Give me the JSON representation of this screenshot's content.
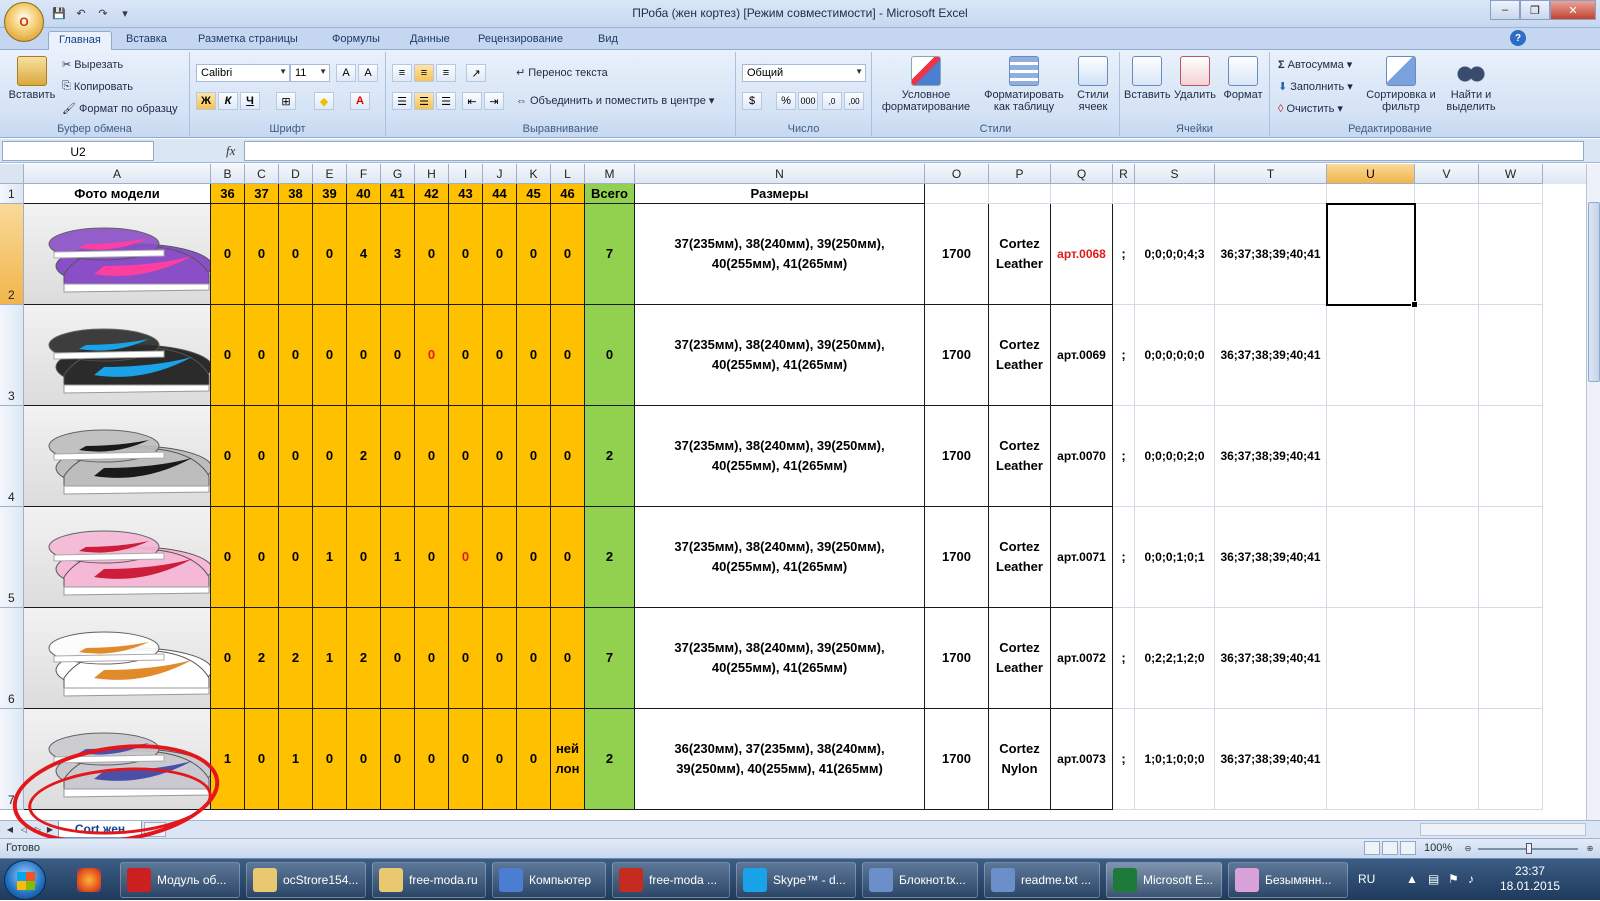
{
  "window": {
    "title": "ПРоба (жен кортез)  [Режим совместимости] - Microsoft Excel",
    "office_button": "O"
  },
  "ribbon_tabs": [
    "Главная",
    "Вставка",
    "Разметка страницы",
    "Формулы",
    "Данные",
    "Рецензирование",
    "Вид"
  ],
  "ribbon": {
    "clipboard": {
      "label": "Буфер обмена",
      "paste": "Вставить",
      "cut": "Вырезать",
      "copy": "Копировать",
      "format_painter": "Формат по образцу"
    },
    "font": {
      "label": "Шрифт",
      "name": "Calibri",
      "size": "11",
      "bold": "Ж",
      "italic": "К",
      "underline": "Ч"
    },
    "alignment": {
      "label": "Выравнивание",
      "wrap": "Перенос текста",
      "merge": "Объединить и поместить в центре"
    },
    "number": {
      "label": "Число",
      "format": "Общий"
    },
    "styles": {
      "label": "Стили",
      "conditional": "Условное форматирование",
      "as_table": "Форматировать как таблицу",
      "cell_styles": "Стили ячеек"
    },
    "cells": {
      "label": "Ячейки",
      "insert": "Вставить",
      "delete": "Удалить",
      "format": "Формат"
    },
    "editing": {
      "label": "Редактирование",
      "autosum": "Автосумма",
      "fill": "Заполнить",
      "clear": "Очистить",
      "sort": "Сортировка и фильтр",
      "find": "Найти и выделить"
    }
  },
  "formula_bar": {
    "name_box": "U2",
    "fx": "fx",
    "value": ""
  },
  "columns": [
    "A",
    "B",
    "C",
    "D",
    "E",
    "F",
    "G",
    "H",
    "I",
    "J",
    "K",
    "L",
    "M",
    "N",
    "O",
    "P",
    "Q",
    "R",
    "S",
    "T",
    "U",
    "V",
    "W"
  ],
  "header_row": [
    "Фото модели",
    "36",
    "37",
    "38",
    "39",
    "40",
    "41",
    "42",
    "43",
    "44",
    "45",
    "46",
    "Всего",
    "Размеры"
  ],
  "rows": [
    {
      "num": "2",
      "sizes": [
        "0",
        "0",
        "0",
        "0",
        "4",
        "3",
        "0",
        "0",
        "0",
        "0",
        "0"
      ],
      "total": "7",
      "dims": "37(235мм), 38(240мм), 39(250мм), 40(255мм), 41(265мм)",
      "price": "1700",
      "model": "Cortez Leather",
      "art": "арт.0068",
      "sep": ";",
      "counts": "0;0;0;0;4;3",
      "list": "36;37;38;39;40;41"
    },
    {
      "num": "3",
      "sizes": [
        "0",
        "0",
        "0",
        "0",
        "0",
        "0",
        "0",
        "0",
        "0",
        "0",
        "0"
      ],
      "total": "0",
      "dims": "37(235мм), 38(240мм), 39(250мм), 40(255мм), 41(265мм)",
      "price": "1700",
      "model": "Cortez Leather",
      "art": "арт.0069",
      "sep": ";",
      "counts": "0;0;0;0;0;0",
      "list": "36;37;38;39;40;41"
    },
    {
      "num": "4",
      "sizes": [
        "0",
        "0",
        "0",
        "0",
        "2",
        "0",
        "0",
        "0",
        "0",
        "0",
        "0"
      ],
      "total": "2",
      "dims": "37(235мм), 38(240мм), 39(250мм), 40(255мм), 41(265мм)",
      "price": "1700",
      "model": "Cortez Leather",
      "art": "арт.0070",
      "sep": ";",
      "counts": "0;0;0;0;2;0",
      "list": "36;37;38;39;40;41"
    },
    {
      "num": "5",
      "sizes": [
        "0",
        "0",
        "0",
        "1",
        "0",
        "1",
        "0",
        "0",
        "0",
        "0",
        "0"
      ],
      "total": "2",
      "dims": "37(235мм), 38(240мм), 39(250мм), 40(255мм), 41(265мм)",
      "price": "1700",
      "model": "Cortez Leather",
      "art": "арт.0071",
      "sep": ";",
      "counts": "0;0;0;1;0;1",
      "list": "36;37;38;39;40;41"
    },
    {
      "num": "6",
      "sizes": [
        "0",
        "2",
        "2",
        "1",
        "2",
        "0",
        "0",
        "0",
        "0",
        "0",
        "0"
      ],
      "total": "7",
      "dims": "37(235мм), 38(240мм), 39(250мм), 40(255мм), 41(265мм)",
      "price": "1700",
      "model": "Cortez Leather",
      "art": "арт.0072",
      "sep": ";",
      "counts": "0;2;2;1;2;0",
      "list": "36;37;38;39;40;41"
    },
    {
      "num": "7",
      "sizes": [
        "1",
        "0",
        "1",
        "0",
        "0",
        "0",
        "0",
        "0",
        "0",
        "0",
        "ней лон"
      ],
      "total": "2",
      "dims": "36(230мм), 37(235мм), 38(240мм), 39(250мм), 40(255мм), 41(265мм)",
      "price": "1700",
      "model": "Cortez Nylon",
      "art": "арт.0073",
      "sep": ";",
      "counts": "1;0;1;0;0;0",
      "list": "36;37;38;39;40;41"
    }
  ],
  "sheet_tab": "Cort жен",
  "status": {
    "text": "Готово",
    "zoom": "100%"
  },
  "taskbar": {
    "items": [
      "Модуль об...",
      "ocStrore154...",
      "free-moda.ru",
      "Компьютер",
      "free-moda ...",
      "Skype™ - d...",
      "Блокнот.tx...",
      "readme.txt ...",
      "Microsoft E...",
      "Безымянн..."
    ],
    "lang": "RU",
    "time": "23:37",
    "date": "18.01.2015"
  },
  "colors": {
    "yellow": "#ffc000",
    "green": "#92d050",
    "red": "#e01b1b"
  }
}
